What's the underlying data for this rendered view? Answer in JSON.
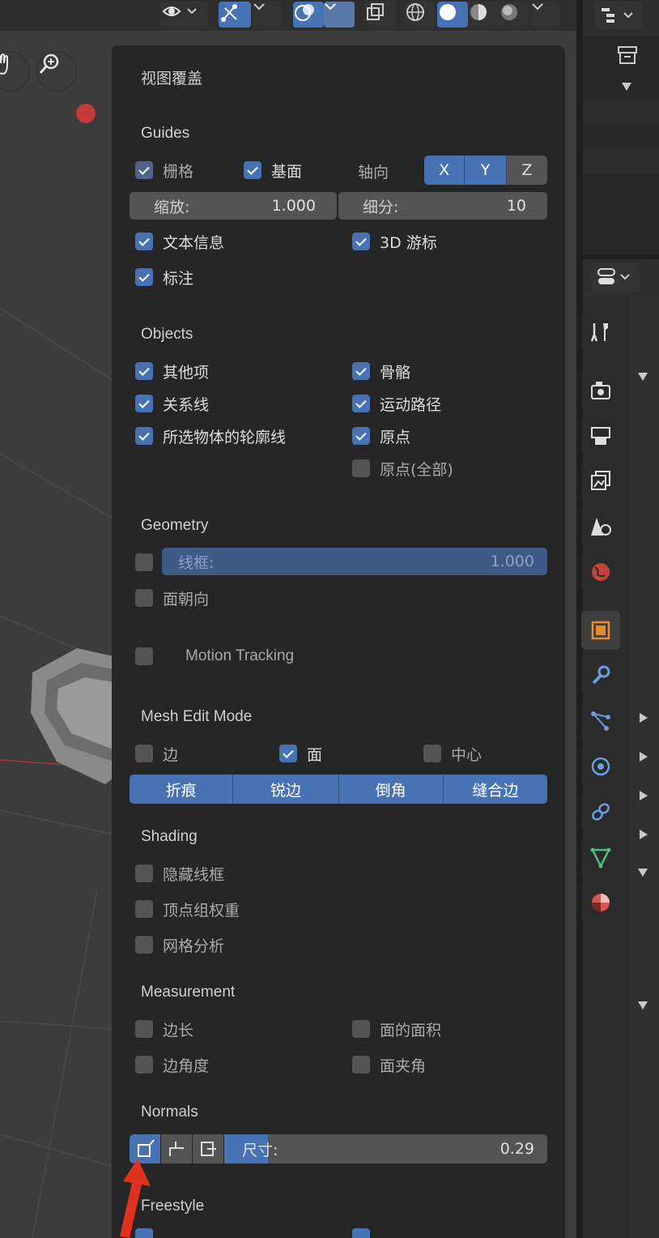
{
  "overlay": {
    "title": "视图覆盖",
    "guides": {
      "heading": "Guides",
      "grid_label": "栅格",
      "floor_label": "基面",
      "axes_label": "轴向",
      "axes": [
        "X",
        "Y",
        "Z"
      ],
      "scale_label": "缩放:",
      "scale_value": "1.000",
      "subdiv_label": "细分:",
      "subdiv_value": "10",
      "text_info_label": "文本信息",
      "cursor_label": "3D 游标",
      "annotations_label": "标注"
    },
    "objects": {
      "heading": "Objects",
      "extras_label": "其他项",
      "bones_label": "骨骼",
      "relationship_label": "关系线",
      "motion_paths_label": "运动路径",
      "outline_label": "所选物体的轮廓线",
      "origins_label": "原点",
      "origins_all_label": "原点(全部)"
    },
    "geometry": {
      "heading": "Geometry",
      "wireframe_label": "线框:",
      "wireframe_value": "1.000",
      "face_orientation_label": "面朝向"
    },
    "motion_tracking_label": "Motion Tracking",
    "mesh_edit": {
      "heading": "Mesh Edit Mode",
      "edges_label": "边",
      "faces_label": "面",
      "center_label": "中心",
      "marks": [
        "折痕",
        "锐边",
        "倒角",
        "缝合边"
      ]
    },
    "shading": {
      "heading": "Shading",
      "hidden_wire_label": "隐藏线框",
      "vertex_weights_label": "顶点组权重",
      "mesh_analysis_label": "网格分析"
    },
    "measurement": {
      "heading": "Measurement",
      "edge_length_label": "边长",
      "face_area_label": "面的面积",
      "edge_angle_label": "边角度",
      "face_angle_label": "面夹角"
    },
    "normals": {
      "heading": "Normals",
      "size_label": "尺寸:",
      "size_value": "0.29"
    },
    "freestyle_heading": "Freestyle"
  },
  "colors": {
    "accent": "#4772b3",
    "panel": "#252525",
    "checkbox_off": "#545454",
    "arrow": "#e0301e"
  },
  "icons": {
    "header": [
      "eye-icon",
      "gizmo-icon",
      "overlay-icon",
      "xray-icon",
      "wireframe-shading-icon",
      "solid-shading-icon",
      "material-shading-icon",
      "rendered-shading-icon"
    ],
    "properties": [
      "tool-icon",
      "render-icon",
      "output-icon",
      "view-layer-icon",
      "scene-icon",
      "world-icon",
      "object-icon",
      "modifier-icon",
      "particles-icon",
      "physics-icon",
      "constraints-icon",
      "data-icon",
      "material-icon"
    ]
  }
}
